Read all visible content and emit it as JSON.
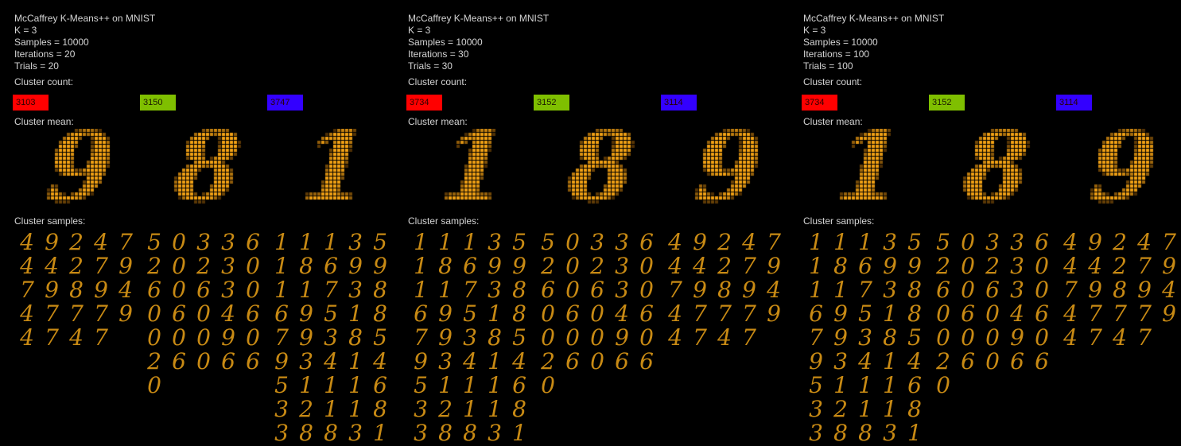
{
  "panels": [
    {
      "title": "McCaffrey K-Means++ on MNIST",
      "k_line": "K = 3",
      "samples_line": "Samples = 10000",
      "iterations_line": "Iterations = 20",
      "trials_line": "Trials = 20",
      "cluster_count_label": "Cluster count:",
      "cluster_mean_label": "Cluster mean:",
      "cluster_samples_label": "Cluster samples:",
      "clusters": [
        {
          "count": "3103",
          "color": "#ff0000",
          "mean_digit": "9",
          "samples": [
            "49247",
            "44279",
            "79894",
            "47779",
            "4747"
          ]
        },
        {
          "count": "3150",
          "color": "#7fbf00",
          "mean_digit": "8",
          "samples": [
            "50336",
            "20230",
            "60630",
            "06046",
            "00090",
            "26066",
            "0"
          ]
        },
        {
          "count": "3747",
          "color": "#3300ff",
          "mean_digit": "1",
          "samples": [
            "11135",
            "18699",
            "11738",
            "69518",
            "79385",
            "93414",
            "51116",
            "32118",
            "38831"
          ]
        }
      ]
    },
    {
      "title": "McCaffrey K-Means++ on MNIST",
      "k_line": "K = 3",
      "samples_line": "Samples = 10000",
      "iterations_line": "Iterations = 30",
      "trials_line": "Trials = 30",
      "cluster_count_label": "Cluster count:",
      "cluster_mean_label": "Cluster mean:",
      "cluster_samples_label": "Cluster samples:",
      "clusters": [
        {
          "count": "3734",
          "color": "#ff0000",
          "mean_digit": "1",
          "samples": [
            "11135",
            "18699",
            "11738",
            "69518",
            "79385",
            "93414",
            "51116",
            "32118",
            "38831"
          ]
        },
        {
          "count": "3152",
          "color": "#7fbf00",
          "mean_digit": "8",
          "samples": [
            "50336",
            "20230",
            "60630",
            "06046",
            "00090",
            "26066",
            "0"
          ]
        },
        {
          "count": "3114",
          "color": "#3300ff",
          "mean_digit": "9",
          "samples": [
            "49247",
            "44279",
            "79894",
            "47779",
            "4747"
          ]
        }
      ]
    },
    {
      "title": "McCaffrey K-Means++ on MNIST",
      "k_line": "K = 3",
      "samples_line": "Samples = 10000",
      "iterations_line": "Iterations = 100",
      "trials_line": "Trials = 100",
      "cluster_count_label": "Cluster count:",
      "cluster_mean_label": "Cluster mean:",
      "cluster_samples_label": "Cluster samples:",
      "clusters": [
        {
          "count": "3734",
          "color": "#ff0000",
          "mean_digit": "1",
          "samples": [
            "11135",
            "18699",
            "11738",
            "69518",
            "79385",
            "93414",
            "51116",
            "32118",
            "38831"
          ]
        },
        {
          "count": "3152",
          "color": "#7fbf00",
          "mean_digit": "8",
          "samples": [
            "50336",
            "20230",
            "60630",
            "06046",
            "00090",
            "26066",
            "0"
          ]
        },
        {
          "count": "3114",
          "color": "#3300ff",
          "mean_digit": "9",
          "samples": [
            "49247",
            "44279",
            "79894",
            "47779",
            "4747"
          ]
        }
      ]
    }
  ]
}
